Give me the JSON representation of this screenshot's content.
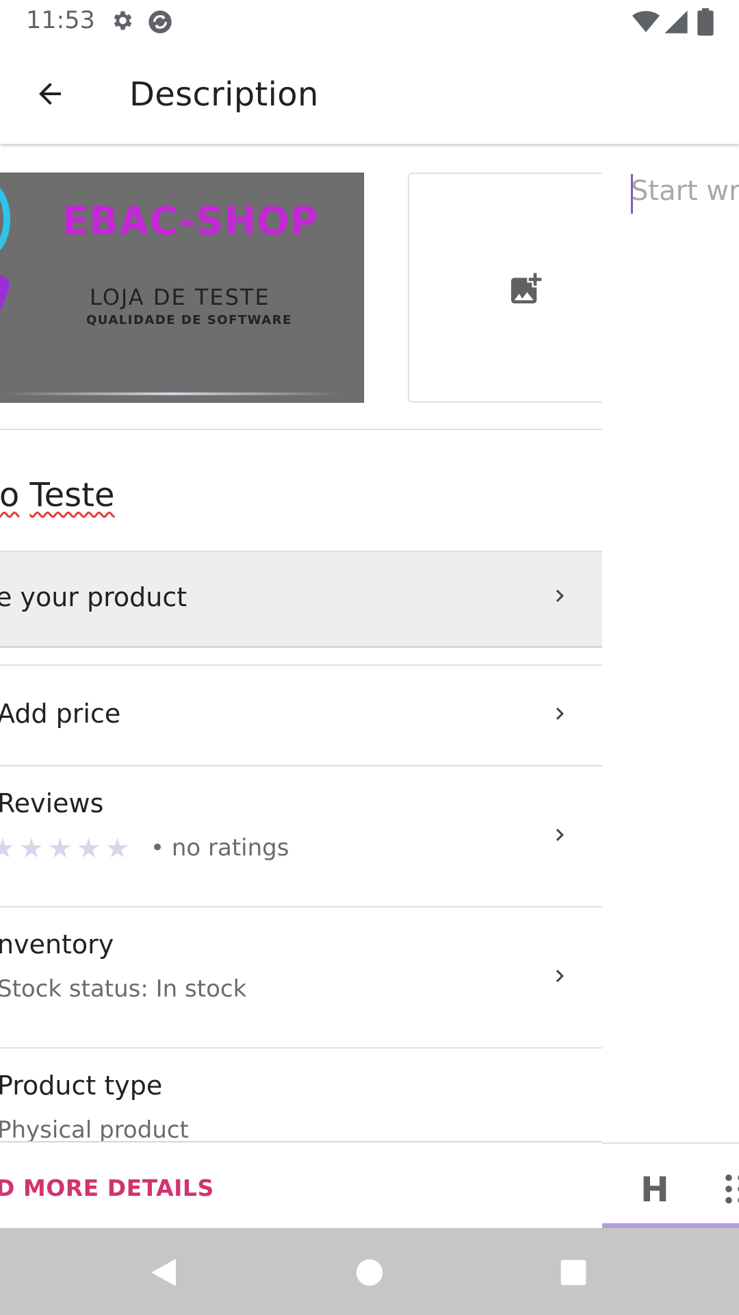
{
  "status_bar": {
    "time": "11:53"
  },
  "app_bar": {
    "title": "Description",
    "back_icon": "arrow-back-icon"
  },
  "product": {
    "image": {
      "logo_title": "EBAC-SHOP",
      "logo_line1": "LOJA DE TESTE",
      "logo_line2": "QUALIDADE DE SOFTWARE"
    },
    "add_image_icon": "add-photo-icon",
    "name_prefix": "to",
    "name_word": "Teste",
    "description_row": {
      "label": "e your product"
    },
    "price_row": {
      "label": "Add price"
    },
    "reviews_row": {
      "label": "Reviews",
      "rating_text": "• no ratings",
      "stars": 5
    },
    "inventory_row": {
      "label": "nventory",
      "subtitle": "Stock status: In stock"
    },
    "product_type_row": {
      "label": "Product type",
      "subtitle": "Physical product"
    },
    "more_details_button": "D MORE DETAILS"
  },
  "editor": {
    "placeholder": "Start wri",
    "heading_button": "H"
  },
  "colors": {
    "accent": "#7e57c2",
    "more_details": "#d1336f",
    "nav_bar": "#c6c6c6"
  }
}
